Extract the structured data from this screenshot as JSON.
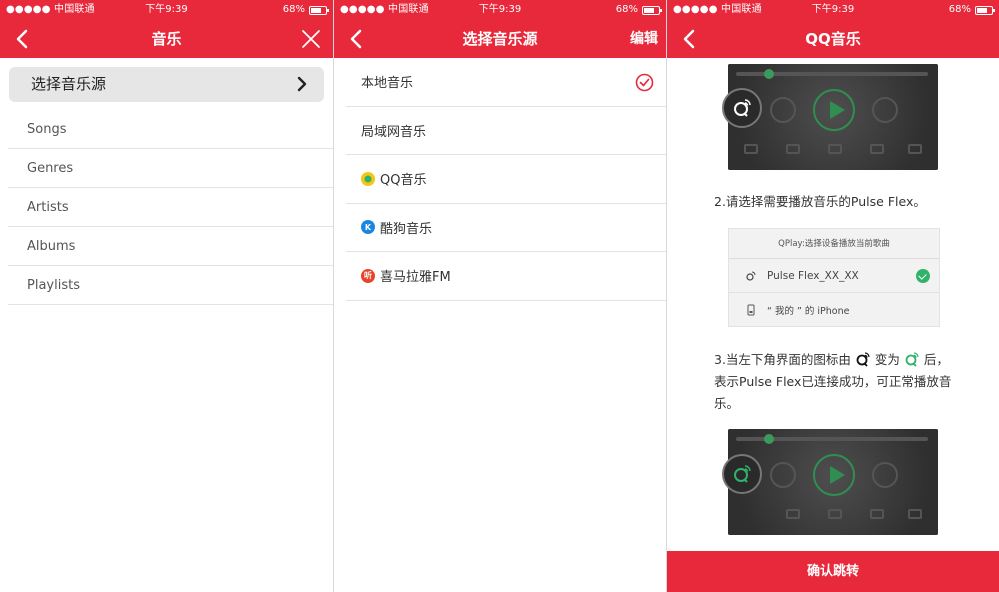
{
  "status_bar": {
    "signal": "●●●●●",
    "carrier": "中国联通",
    "time": "下午9:39",
    "battery": "68%"
  },
  "panel1": {
    "title": "音乐",
    "source_button": "选择音乐源",
    "items": [
      "Songs",
      "Genres",
      "Artists",
      "Albums",
      "Playlists"
    ]
  },
  "panel2": {
    "title": "选择音乐源",
    "edit": "编辑",
    "items": [
      {
        "label": "本地音乐",
        "icon": "",
        "selected": true
      },
      {
        "label": "局域网音乐",
        "icon": ""
      },
      {
        "label": "QQ音乐",
        "icon": "qq-music-logo"
      },
      {
        "label": "酷狗音乐",
        "icon": "kugou-logo"
      },
      {
        "label": "喜马拉雅FM",
        "icon": "ximalaya-logo"
      }
    ]
  },
  "panel3": {
    "title": "QQ音乐",
    "step2": "2.请选择需要播放音乐的Pulse Flex。",
    "dialog_title": "QPlay:选择设备播放当前歌曲",
    "dialog_options": [
      "Pulse Flex_XX_XX",
      "“ 我的 ” 的 iPhone"
    ],
    "step3_a": "3.当左下角界面的图标由",
    "step3_b": "变为",
    "step3_c": "后，表示Pulse Flex已连接成功，可正常播放音乐。",
    "confirm": "确认跳转"
  },
  "colors": {
    "accent": "#e8293b",
    "green": "#2fb36a"
  }
}
